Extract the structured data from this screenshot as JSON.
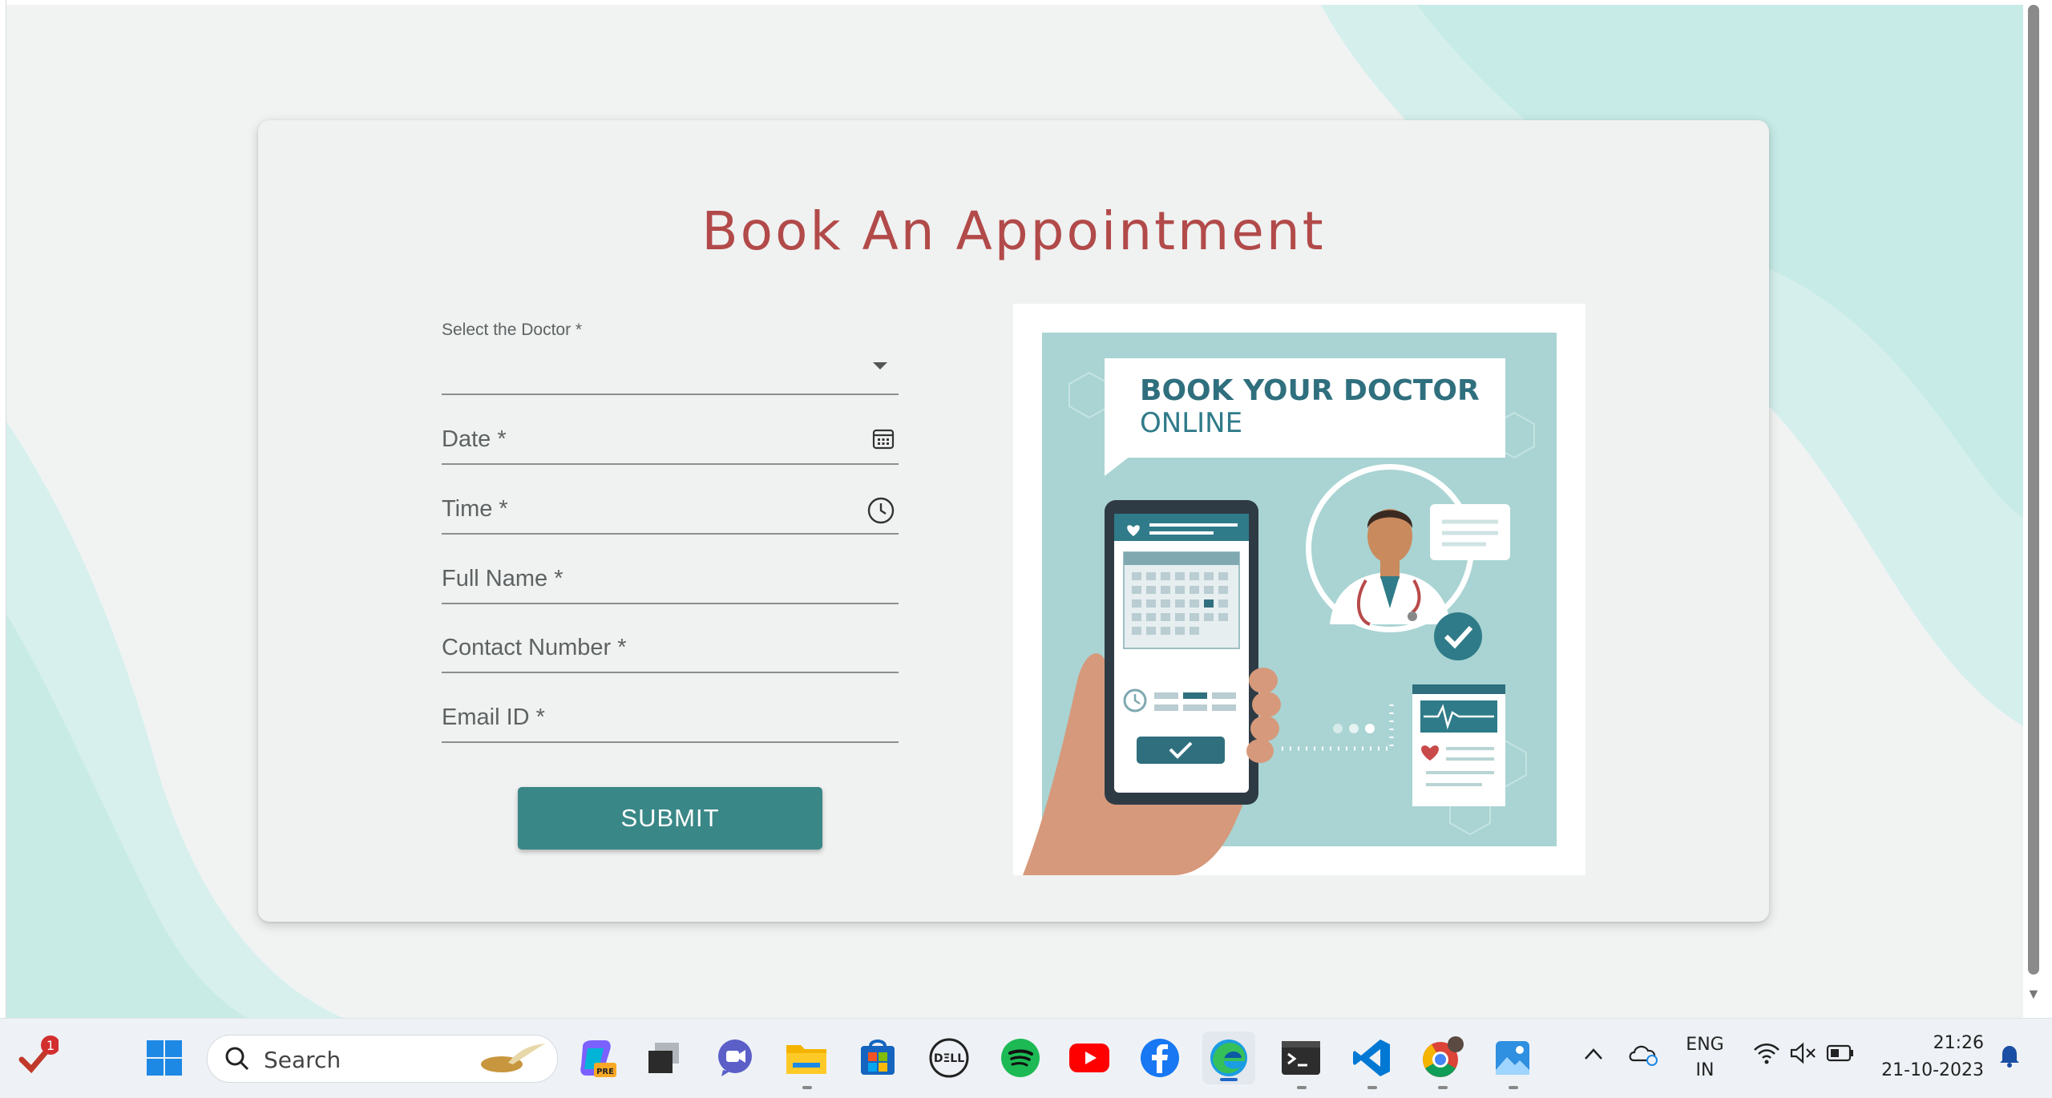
{
  "form": {
    "title": "Book An Appointment",
    "doctor_label": "Select the Doctor *",
    "date_label": "Date *",
    "time_label": "Time *",
    "full_name_label": "Full Name *",
    "contact_label": "Contact Number *",
    "email_label": "Email ID *",
    "submit_label": "SUBMIT"
  },
  "illustration": {
    "headline": "BOOK YOUR DOCTOR",
    "subline": "ONLINE"
  },
  "taskbar": {
    "notification_count": "1",
    "search_placeholder": "Search",
    "search_badge": "PRE",
    "language": "ENG",
    "region": "IN",
    "time": "21:26",
    "date": "21-10-2023",
    "apps": [
      "start-icon",
      "copilot-icon",
      "task-view-icon",
      "meet-icon",
      "file-explorer-icon",
      "store-icon",
      "dell-icon",
      "spotify-icon",
      "youtube-icon",
      "facebook-icon",
      "edge-icon",
      "terminal-icon",
      "vscode-icon",
      "chrome-icon",
      "photos-icon"
    ]
  },
  "colors": {
    "title": "#b24a4a",
    "submit": "#3a8787",
    "accent_teal": "#2f7b89"
  }
}
